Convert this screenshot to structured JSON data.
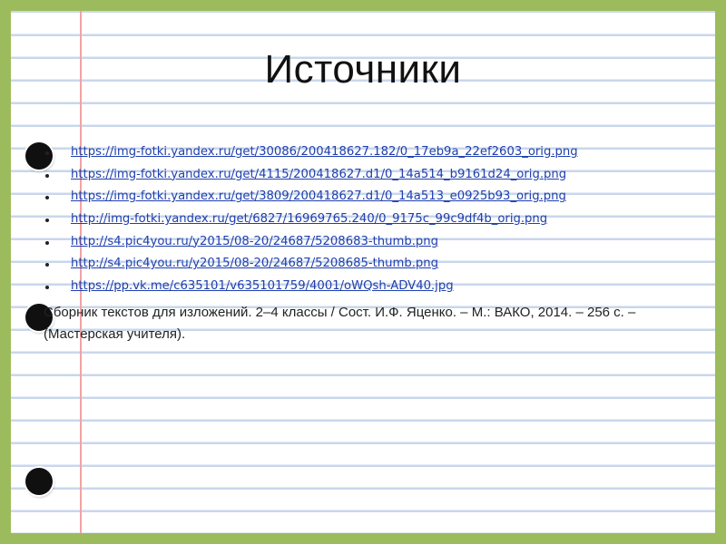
{
  "slide": {
    "title": "Источники",
    "links": [
      "https://img-fotki.yandex.ru/get/30086/200418627.182/0_17eb9a_22ef2603_orig.png",
      "https://img-fotki.yandex.ru/get/4115/200418627.d1/0_14a514_b9161d24_orig.png",
      "https://img-fotki.yandex.ru/get/3809/200418627.d1/0_14a513_e0925b93_orig.png",
      "http://img-fotki.yandex.ru/get/6827/16969765.240/0_9175c_99c9df4b_orig.png",
      "http://s4.pic4you.ru/y2015/08-20/24687/5208683-thumb.png",
      "http://s4.pic4you.ru/y2015/08-20/24687/5208685-thumb.png",
      "https://pp.vk.me/c635101/v635101759/4001/oWQsh-ADV40.jpg"
    ],
    "credit": "Сборник текстов для изложений. 2–4 классы / Сост. И.Ф. Яценко. – М.: ВАКО, 2014. – 256 с. – (Мастерская учителя)."
  },
  "colors": {
    "frame": "#9cbb5c",
    "ruled_line": "#c9d7ec",
    "margin_line": "#f2a3a3",
    "link": "#1f3fae"
  },
  "decor": {
    "binder_hole_icon_count": 3
  }
}
